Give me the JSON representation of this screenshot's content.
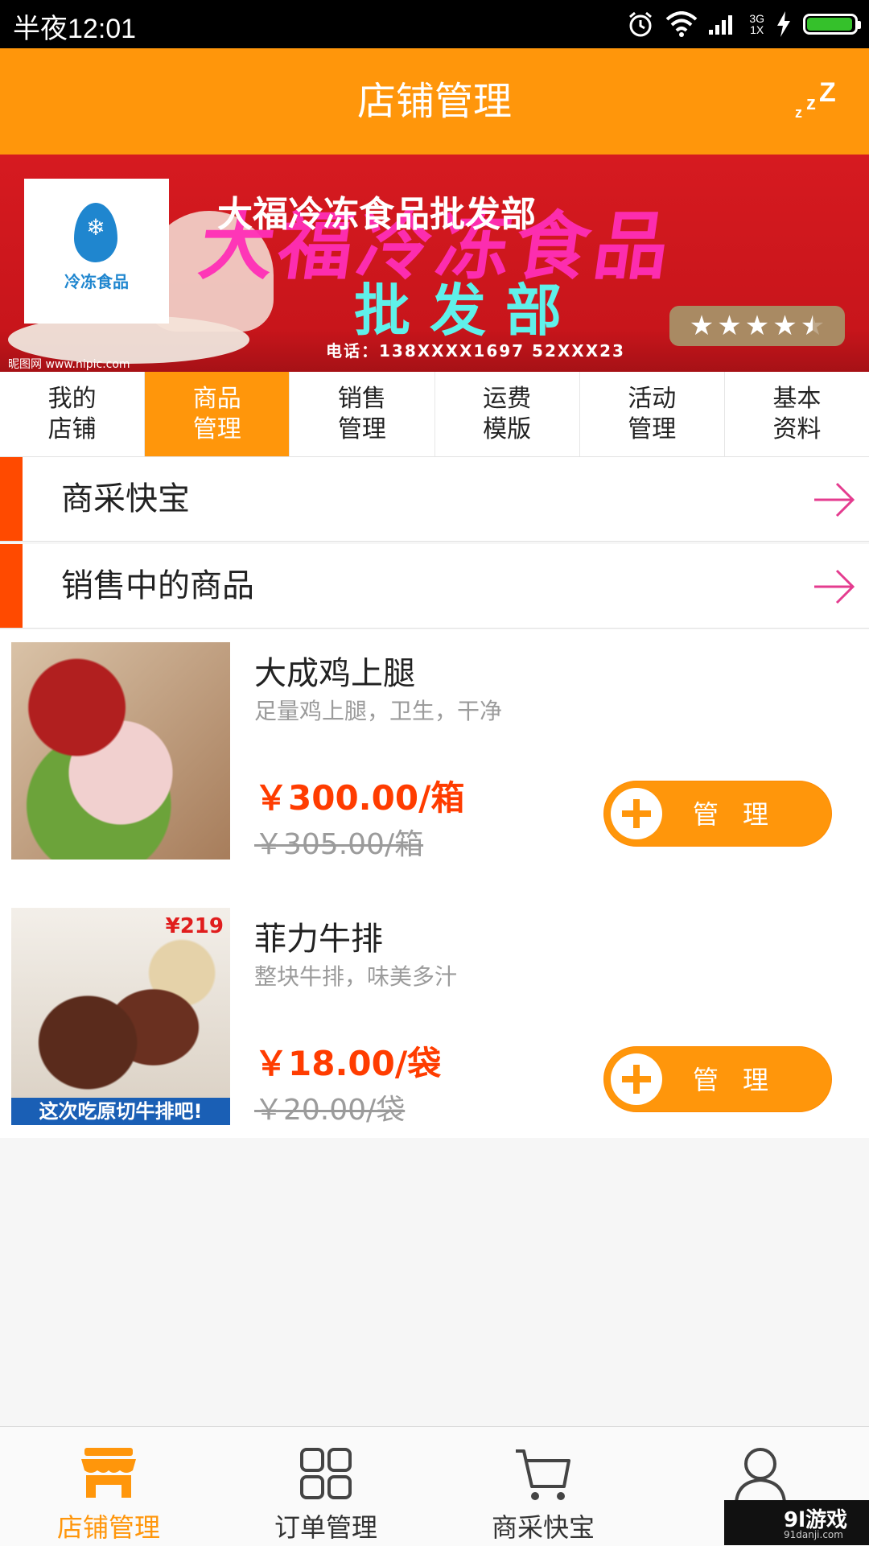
{
  "status_bar": {
    "time": "半夜12:01",
    "network_top": "3G",
    "network_bottom": "1X"
  },
  "header": {
    "title": "店铺管理"
  },
  "banner": {
    "store_name": "大福冷冻食品批发部",
    "logo_text": "冷冻食品",
    "background_title": "大福冷冻食品",
    "background_subtitle": "批发部",
    "phone": "电话：138XXXX1697 52XXX23",
    "credit": "昵图网 www.nipic.com",
    "rating_stars": 4.5
  },
  "tabs": [
    {
      "label": "我的店铺",
      "active": false
    },
    {
      "label": "商品管理",
      "active": true
    },
    {
      "label": "销售管理",
      "active": false
    },
    {
      "label": "运费模版",
      "active": false
    },
    {
      "label": "活动管理",
      "active": false
    },
    {
      "label": "基本资料",
      "active": false
    }
  ],
  "sections": [
    {
      "label": "商采快宝"
    },
    {
      "label": "销售中的商品"
    }
  ],
  "products": [
    {
      "name": "大成鸡上腿",
      "desc": "足量鸡上腿，卫生，干净",
      "price": "￥300.00/箱",
      "old_price": "￥305.00/箱",
      "button": "管理"
    },
    {
      "name": "菲力牛排",
      "desc": "整块牛排，味美多汁",
      "price": "￥18.00/袋",
      "old_price": "￥20.00/袋",
      "button": "管理",
      "image_tag": "这次吃原切牛排吧!",
      "image_price": "¥219"
    }
  ],
  "bottom_nav": [
    {
      "label": "店铺管理",
      "icon": "store-icon",
      "active": true
    },
    {
      "label": "订单管理",
      "icon": "grid-icon",
      "active": false
    },
    {
      "label": "商采快宝",
      "icon": "cart-icon",
      "active": false
    },
    {
      "label": "我",
      "icon": "user-icon",
      "active": false
    }
  ],
  "watermark": {
    "main": "9l游戏",
    "sub": "91danji.com"
  },
  "colors": {
    "primary": "#ff960b",
    "accent": "#ff4a00",
    "price": "#ff3c00"
  }
}
